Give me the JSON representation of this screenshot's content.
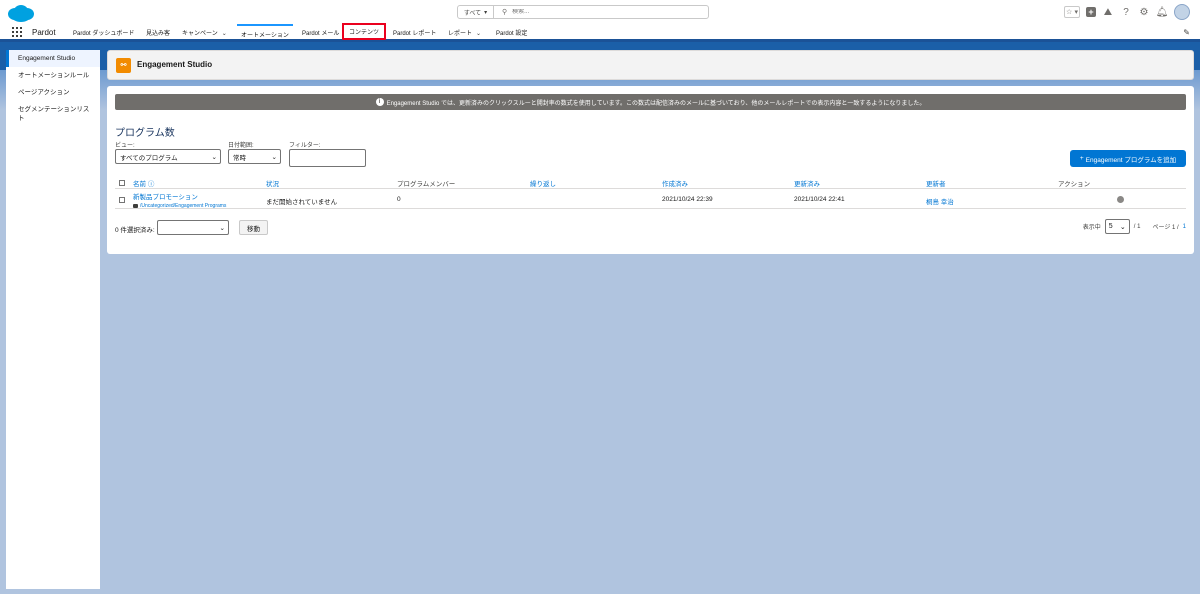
{
  "header": {
    "search_scope": "すべて",
    "search_placeholder": "検索..."
  },
  "nav": {
    "app_name": "Pardot",
    "tabs": [
      {
        "label": "Pardot ダッシュボード"
      },
      {
        "label": "見込み客"
      },
      {
        "label": "キャンペーン"
      },
      {
        "label": "オートメーション"
      },
      {
        "label": "Pardot メール"
      },
      {
        "label": "コンテンツ"
      },
      {
        "label": "Pardot レポート"
      },
      {
        "label": "レポート"
      },
      {
        "label": "Pardot 設定"
      }
    ]
  },
  "sidebar": {
    "items": [
      {
        "label": "Engagement Studio"
      },
      {
        "label": "オートメーションルール"
      },
      {
        "label": "ページアクション"
      },
      {
        "label": "セグメンテーションリスト"
      }
    ]
  },
  "page": {
    "title": "Engagement Studio",
    "icon_glyph": "⚯"
  },
  "notice": {
    "icon": "i",
    "text": "Engagement Studio では、更新済みのクリックスルーと開封率の数式を使用しています。この数式は配信済みのメールに基づいており、他のメールレポートでの表示内容と一致するようになりました。"
  },
  "main": {
    "section_title": "プログラム数",
    "view_label": "ビュー:",
    "view_value": "すべてのプログラム",
    "date_label": "日付範囲:",
    "date_value": "常時",
    "filter_label": "フィルター:",
    "filter_value": "",
    "add_button": "Engagement プログラムを追加",
    "add_button_icon": "+"
  },
  "table": {
    "headers": {
      "name": "名前",
      "status": "状況",
      "members": "プログラムメンバー",
      "repeat": "繰り返し",
      "created": "作成済み",
      "updated": "更新済み",
      "updater": "更新者",
      "action": "アクション"
    },
    "rows": [
      {
        "name": "新製品プロモーション",
        "folder": "/Uncategorized/Engagement Programs",
        "status": "まだ開始されていません",
        "members": "0",
        "created": "2021/10/24 22:39",
        "updated": "2021/10/24 22:41",
        "updater": "桐島 幸治"
      }
    ]
  },
  "footer": {
    "selected_label": "0 件選択済み:",
    "move_button": "移動",
    "display_label": "表示中",
    "per_page": "5",
    "per_page_total": "/ 1",
    "page_label": "ページ 1 /",
    "page_total": "1"
  },
  "colors": {
    "brand_blue": "#0176d3",
    "band_blue": "#1b5fa8",
    "highlight_red": "#ea001e",
    "es_orange": "#f28b00"
  }
}
